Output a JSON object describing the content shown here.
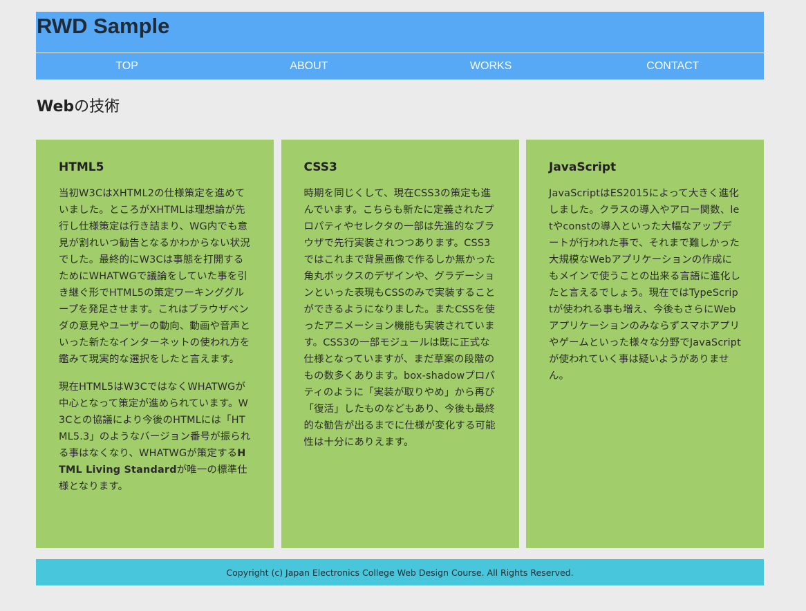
{
  "header": {
    "title": "RWD Sample"
  },
  "nav": {
    "items": [
      {
        "label": "TOP"
      },
      {
        "label": "ABOUT"
      },
      {
        "label": "WORKS"
      },
      {
        "label": "CONTACT"
      }
    ]
  },
  "main": {
    "section_title_bold": "Web",
    "section_title_rest": "の技術",
    "cards": [
      {
        "title": "HTML5",
        "p1": "当初W3CはXHTML2の仕様策定を進めていました。ところがXHTMLは理想論が先行し仕様策定は行き詰まり、WG内でも意見が割れいつ勧告となるかわからない状況でした。最終的にW3Cは事態を打開するためにWHATWGで議論をしていた事を引き継ぐ形でHTML5の策定ワーキンググループを発足させます。これはブラウザベンダの意見やユーザーの動向、動画や音声といった新たなインターネットの使われ方を鑑みて現実的な選択をしたと言えます。",
        "p2_pre": "現在HTML5はW3CではなくWHATWGが中心となって策定が進められています。W3Cとの協議により今後のHTMLには「HTML5.3」のようなバージョン番号が振られる事はなくなり、WHATWGが策定する",
        "p2_bold": "HTML Living Standard",
        "p2_post": "が唯一の標準仕様となります。"
      },
      {
        "title": "CSS3",
        "p1": "時期を同じくして、現在CSS3の策定も進んでいます。こちらも新たに定義されたプロパティやセレクタの一部は先進的なブラウザで先行実装されつつあります。CSS3ではこれまで背景画像で作るしか無かった角丸ボックスのデザインや、グラデーションといった表現もCSSのみで実装することができるようになりました。またCSSを使ったアニメーション機能も実装されています。CSS3の一部モジュールは既に正式な仕様となっていますが、まだ草案の段階のもの数多くあります。box-shadowプロパティのように「実装が取りやめ」から再び「復活」したものなどもあり、今後も最終的な勧告が出るまでに仕様が変化する可能性は十分にありえます。"
      },
      {
        "title": "JavaScript",
        "p1": "JavaScriptはES2015によって大きく進化しました。クラスの導入やアロー関数、letやconstの導入といった大幅なアップデートが行われた事で、それまで難しかった大規模なWebアプリケーションの作成にもメインで使うことの出来る言語に進化したと言えるでしょう。現在ではTypeScriptが使われる事も増え、今後もさらにWebアプリケーションのみならずスマホアプリやゲームといった様々な分野でJavaScriptが使われていく事は疑いようがありません。"
      }
    ]
  },
  "footer": {
    "copyright": "Copyright (c) Japan Electronics College Web Design Course. All Rights Reserved."
  },
  "colors": {
    "header_bg": "#57a8f5",
    "card_bg": "#a2cd6b",
    "footer_bg": "#48c6dc",
    "page_bg": "#ebebeb"
  }
}
